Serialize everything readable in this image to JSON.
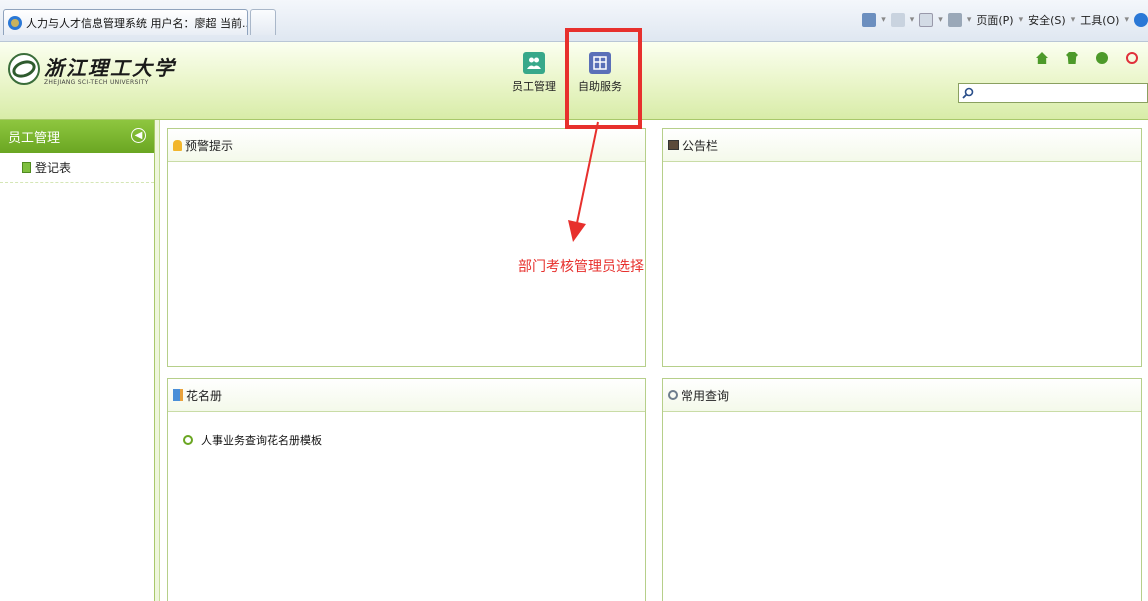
{
  "browser": {
    "tab_title": "人力与人才信息管理系统 用户名：廖超  当前...",
    "commands": {
      "page": "页面(P)",
      "safety": "安全(S)",
      "tools": "工具(O)"
    }
  },
  "header": {
    "logo_cn": "浙江理工大学",
    "logo_en": "ZHEJIANG SCI-TECH UNIVERSITY",
    "modules": [
      {
        "label": "员工管理",
        "icon": "users-icon"
      },
      {
        "label": "自助服务",
        "icon": "window-icon"
      }
    ],
    "search": {
      "value": "",
      "placeholder": ""
    }
  },
  "sidebar": {
    "title": "员工管理",
    "items": [
      {
        "label": "登记表",
        "icon": "document-icon"
      }
    ]
  },
  "panels": {
    "warning": {
      "title": "预警提示"
    },
    "notice": {
      "title": "公告栏"
    },
    "roster": {
      "title": "花名册",
      "links": [
        "人事业务查询花名册模板"
      ]
    },
    "query": {
      "title": "常用查询"
    }
  },
  "annotation": {
    "text": "部门考核管理员选择",
    "color": "#e7302d"
  },
  "colors": {
    "accent_green": "#6aa622",
    "highlight_red": "#e7302d"
  }
}
